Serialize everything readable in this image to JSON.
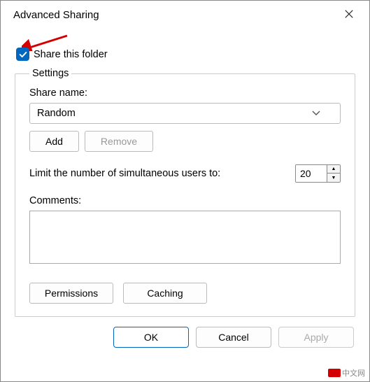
{
  "window": {
    "title": "Advanced Sharing"
  },
  "share_checkbox": {
    "checked": true,
    "label": "Share this folder"
  },
  "settings": {
    "legend": "Settings",
    "share_name_label": "Share name:",
    "share_name_value": "Random",
    "add_label": "Add",
    "remove_label": "Remove",
    "limit_label": "Limit the number of simultaneous users to:",
    "limit_value": "20",
    "comments_label": "Comments:",
    "comments_value": "",
    "permissions_label": "Permissions",
    "caching_label": "Caching"
  },
  "footer": {
    "ok": "OK",
    "cancel": "Cancel",
    "apply": "Apply"
  },
  "watermark": {
    "text": "中文网"
  }
}
